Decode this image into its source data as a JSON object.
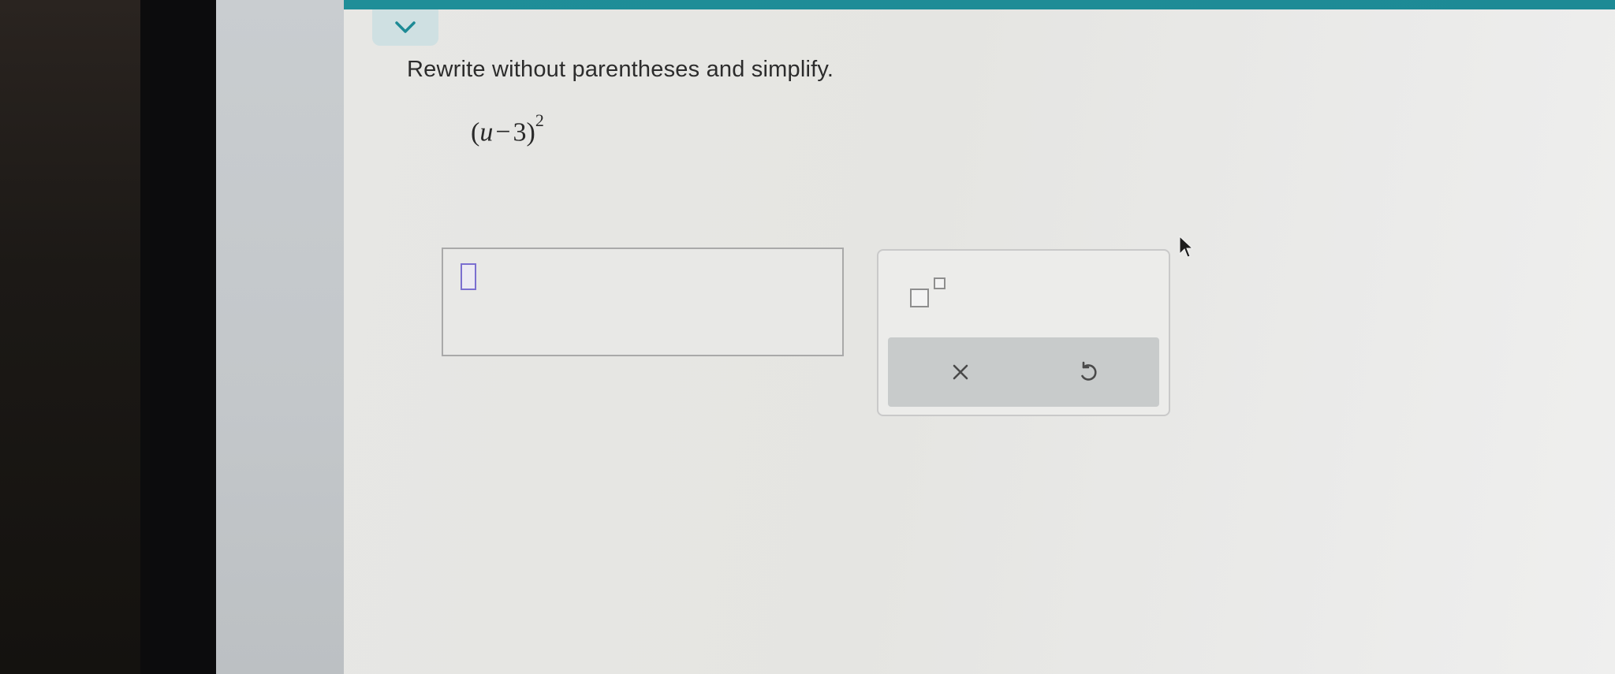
{
  "problem": {
    "instruction": "Rewrite without parentheses and simplify.",
    "expression": {
      "open": "(",
      "variable": "u",
      "operator": "−",
      "constant": "3",
      "close": ")",
      "exponent": "2"
    }
  },
  "answer": {
    "value": ""
  },
  "toolbox": {
    "exponent_button": "exponent-template",
    "clear_symbol": "×",
    "undo_symbol": "undo-icon"
  },
  "colors": {
    "top_bar": "#1f8e98",
    "cursor_box": "#7b6fd0",
    "action_bar": "#c8cbcb"
  }
}
